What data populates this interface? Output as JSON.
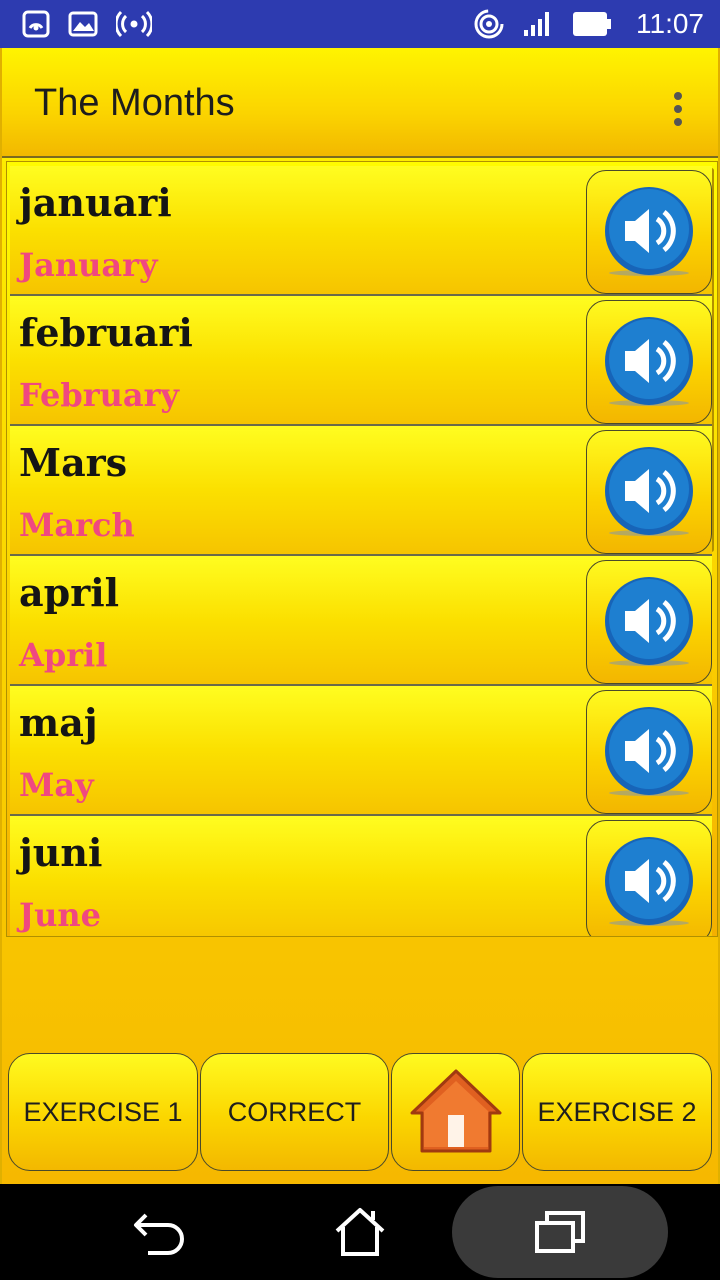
{
  "status_bar": {
    "time": "11:07"
  },
  "toolbar": {
    "title": "The Months"
  },
  "months": [
    {
      "word": "januari",
      "translation": "January"
    },
    {
      "word": "februari",
      "translation": "February"
    },
    {
      "word": "Mars",
      "translation": "March"
    },
    {
      "word": "april",
      "translation": "April"
    },
    {
      "word": "maj",
      "translation": "May"
    },
    {
      "word": "juni",
      "translation": "June"
    }
  ],
  "bottom_buttons": {
    "exercise1": "EXERCISE 1",
    "correct": "CORRECT",
    "exercise2": "EXERCISE 2"
  },
  "colors": {
    "status_bar": "#2d3bb0",
    "translation": "#f04880",
    "speaker_blue": "#1a6fc0"
  }
}
